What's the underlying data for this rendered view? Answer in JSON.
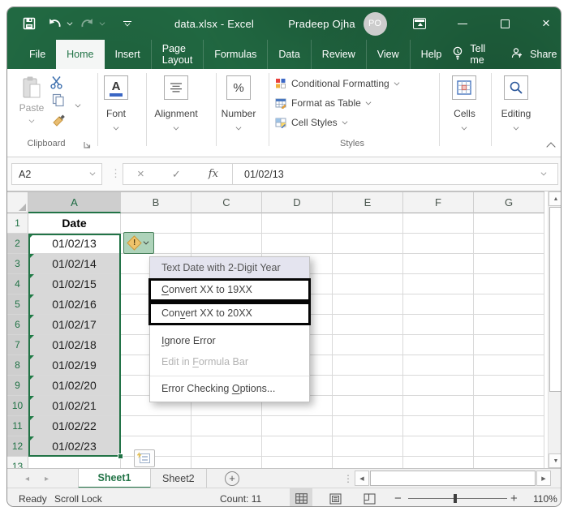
{
  "window": {
    "title": "data.xlsx - Excel",
    "user_name": "Pradeep Ojha",
    "user_initials": "PO"
  },
  "ribbon": {
    "tabs": [
      "File",
      "Home",
      "Insert",
      "Page Layout",
      "Formulas",
      "Data",
      "Review",
      "View",
      "Help"
    ],
    "active_tab": "Home",
    "tell_me": "Tell me",
    "share": "Share",
    "groups": {
      "clipboard": {
        "paste": "Paste",
        "label": "Clipboard"
      },
      "font": {
        "label": "Font"
      },
      "alignment": {
        "label": "Alignment"
      },
      "number": {
        "label": "Number",
        "symbol": "%"
      },
      "styles": {
        "items": [
          "Conditional Formatting",
          "Format as Table",
          "Cell Styles"
        ],
        "label": "Styles"
      },
      "cells": {
        "label": "Cells"
      },
      "editing": {
        "label": "Editing"
      }
    }
  },
  "formula_bar": {
    "name_box": "A2",
    "formula": "01/02/13"
  },
  "grid": {
    "columns": [
      "A",
      "B",
      "C",
      "D",
      "E",
      "F",
      "G"
    ],
    "row_numbers": [
      "1",
      "2",
      "3",
      "4",
      "5",
      "6",
      "7",
      "8",
      "9",
      "10",
      "11",
      "12",
      "13"
    ],
    "header_cell": "Date",
    "dates": [
      "01/02/13",
      "01/02/14",
      "01/02/15",
      "01/02/16",
      "01/02/17",
      "01/02/18",
      "01/02/19",
      "01/02/20",
      "01/02/21",
      "01/02/22",
      "01/02/23"
    ]
  },
  "error_menu": {
    "header": "Text Date with 2-Digit Year",
    "items": [
      {
        "label": "Convert XX to 19XX",
        "u": 0,
        "boxed": true
      },
      {
        "label": "Convert XX to 20XX",
        "u": 3,
        "boxed": true
      },
      {
        "label": "Ignore Error",
        "u": 0,
        "gap": true
      },
      {
        "label": "Edit in Formula Bar",
        "u": 8,
        "disabled": true
      },
      {
        "label": "Error Checking Options...",
        "u": 15,
        "sep": true
      }
    ]
  },
  "sheet_bar": {
    "tabs": [
      "Sheet1",
      "Sheet2"
    ],
    "active_tab": "Sheet1"
  },
  "status_bar": {
    "mode": "Ready",
    "scroll_lock": "Scroll Lock",
    "count": "Count: 11",
    "zoom_level": "110%"
  },
  "icons": {
    "cancel": "×",
    "enter": "✓",
    "fx": "fx",
    "percent": "%",
    "font_letter": "A",
    "close": "×",
    "plus": "+",
    "warning_mark": "!",
    "more_dots": "⋮",
    "up_arrow": "▲",
    "down_arrow": "▼",
    "left_arrow": "◀",
    "right_arrow": "▶",
    "nav_left": "◂",
    "nav_right": "▸",
    "minus": "−",
    "zoom_out": "−",
    "zoom_in": "+"
  },
  "colors": {
    "accent_green": "#217346",
    "titlebar_green": "#216942",
    "selection_gray": "#d8d8d8",
    "warning_yellow": "#efc36b",
    "annotation_black": "#050505"
  }
}
